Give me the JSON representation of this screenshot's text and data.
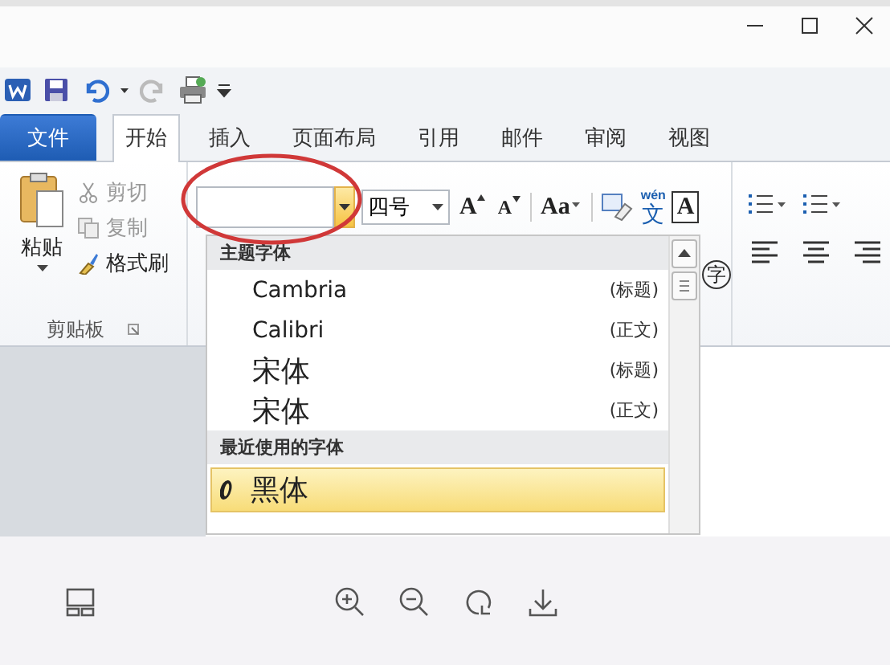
{
  "tabs": [
    {
      "label": "文件",
      "kind": "file",
      "selected": false
    },
    {
      "label": "开始",
      "kind": "tab",
      "selected": true
    },
    {
      "label": "插入",
      "kind": "tab",
      "selected": false
    },
    {
      "label": "页面布局",
      "kind": "tab",
      "selected": false
    },
    {
      "label": "引用",
      "kind": "tab",
      "selected": false
    },
    {
      "label": "邮件",
      "kind": "tab",
      "selected": false
    },
    {
      "label": "审阅",
      "kind": "tab",
      "selected": false
    },
    {
      "label": "视图",
      "kind": "tab",
      "selected": false
    }
  ],
  "clipboard": {
    "paste": "粘贴",
    "commands": [
      {
        "label": "剪切",
        "disabled": true
      },
      {
        "label": "复制",
        "disabled": true
      },
      {
        "label": "格式刷",
        "disabled": false
      }
    ],
    "group_label": "剪贴板"
  },
  "font_group": {
    "font_name_expanded": true,
    "font_size": "四号",
    "buttons": [
      {
        "label": "A",
        "kind": "grow"
      },
      {
        "label": "A",
        "kind": "shrink"
      },
      {
        "label": "Aa",
        "kind": "case"
      }
    ],
    "phonetic_pinyin": "wén",
    "phonetic_char": "文",
    "border_char": "A",
    "enclose_char": "字"
  },
  "font_list": {
    "sections": [
      {
        "heading": "主题字体",
        "items": [
          {
            "name": "Cambria",
            "tag": "(标题)",
            "selected": false
          },
          {
            "name": "Calibri",
            "tag": "(正文)",
            "selected": false
          },
          {
            "name": "宋体",
            "tag": "(标题)",
            "selected": false
          },
          {
            "name": "宋体",
            "tag": "(正文)",
            "selected": false
          }
        ]
      },
      {
        "heading": "最近使用的字体",
        "items": [
          {
            "name": "黑体",
            "selected": true
          }
        ]
      }
    ]
  }
}
